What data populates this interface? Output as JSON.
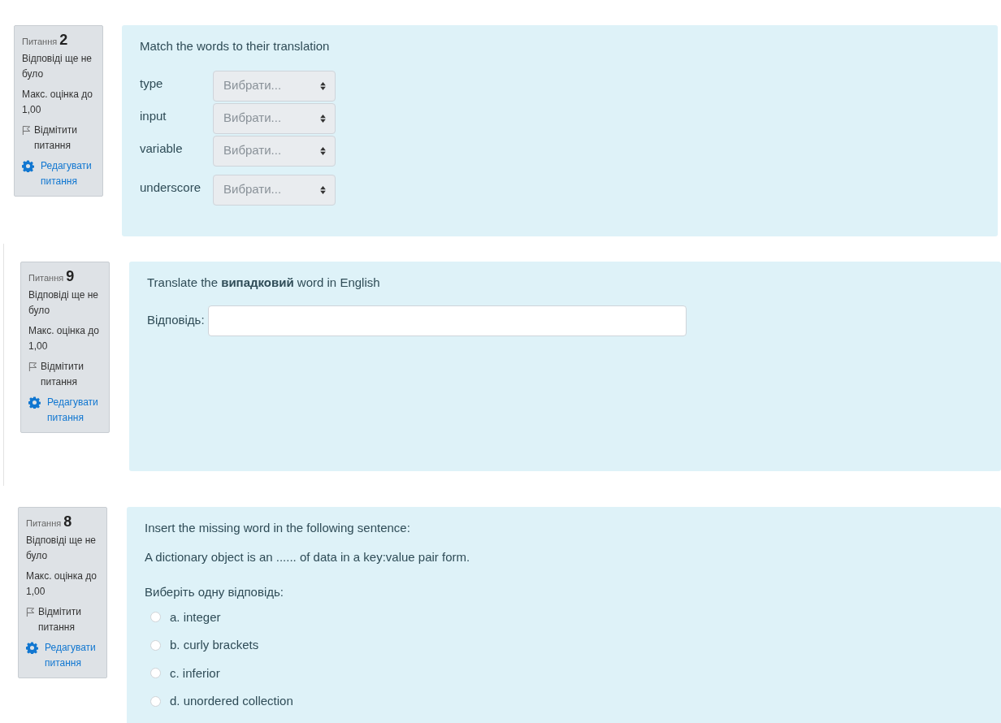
{
  "questions": [
    {
      "kind": "match",
      "label": "Питання",
      "number": "2",
      "status": "Відповіді ще не було",
      "max_grade": "Макс. оцінка до 1,00",
      "flag_link": "Відмітити питання",
      "edit_link": "Редагувати питання",
      "text": "Match the words to their translation",
      "rows": [
        {
          "word": "type",
          "choice": "Вибрати..."
        },
        {
          "word": "input",
          "choice": "Вибрати..."
        },
        {
          "word": "variable",
          "choice": "Вибрати..."
        },
        {
          "word": "underscore",
          "choice": "Вибрати..."
        }
      ]
    },
    {
      "kind": "shortanswer",
      "label": "Питання",
      "number": "9",
      "status": "Відповіді ще не було",
      "max_grade": "Макс. оцінка до 1,00",
      "flag_link": "Відмітити питання",
      "edit_link": "Редагувати питання",
      "text": "Translate the **випадковий** word in English",
      "answer_label": "Відповідь:"
    },
    {
      "kind": "multichoice",
      "label": "Питання",
      "number": "8",
      "status": "Відповіді ще не було",
      "max_grade": "Макс. оцінка до 1,00",
      "flag_link": "Відмітити питання",
      "edit_link": "Редагувати питання",
      "text": "Insert the missing word in the following sentence:",
      "sentence": "A dictionary object is an ...... of data in a key:value pair form.",
      "prompt": "Виберіть одну відповідь:",
      "options": [
        {
          "label": "a. integer",
          "selected": false
        },
        {
          "label": "b. curly brackets",
          "selected": false
        },
        {
          "label": "c. inferior",
          "selected": false
        },
        {
          "label": "d. unordered collection",
          "selected": false
        }
      ]
    }
  ]
}
